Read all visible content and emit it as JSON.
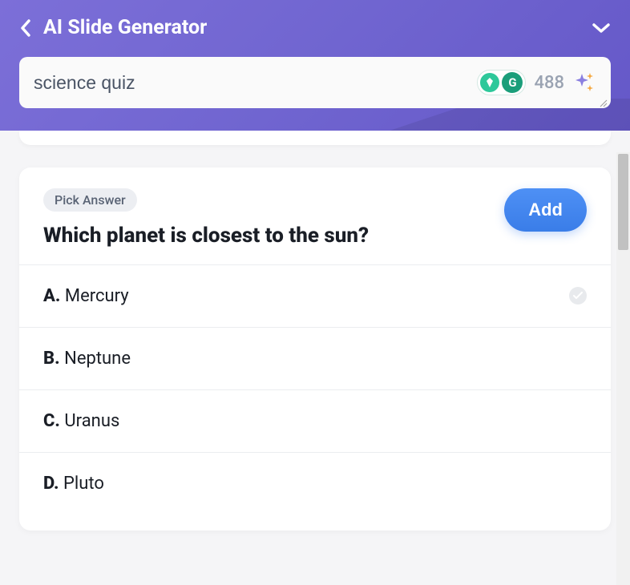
{
  "header": {
    "title": "AI Slide Generator"
  },
  "search": {
    "value": "science quiz",
    "counter": "488"
  },
  "question": {
    "badge": "Pick Answer",
    "text": "Which planet is closest to the sun?",
    "addButton": "Add",
    "options": [
      {
        "letter": "A.",
        "value": "Mercury",
        "correct": true
      },
      {
        "letter": "B.",
        "value": "Neptune",
        "correct": false
      },
      {
        "letter": "C.",
        "value": "Uranus",
        "correct": false
      },
      {
        "letter": "D.",
        "value": "Pluto",
        "correct": false
      }
    ]
  }
}
